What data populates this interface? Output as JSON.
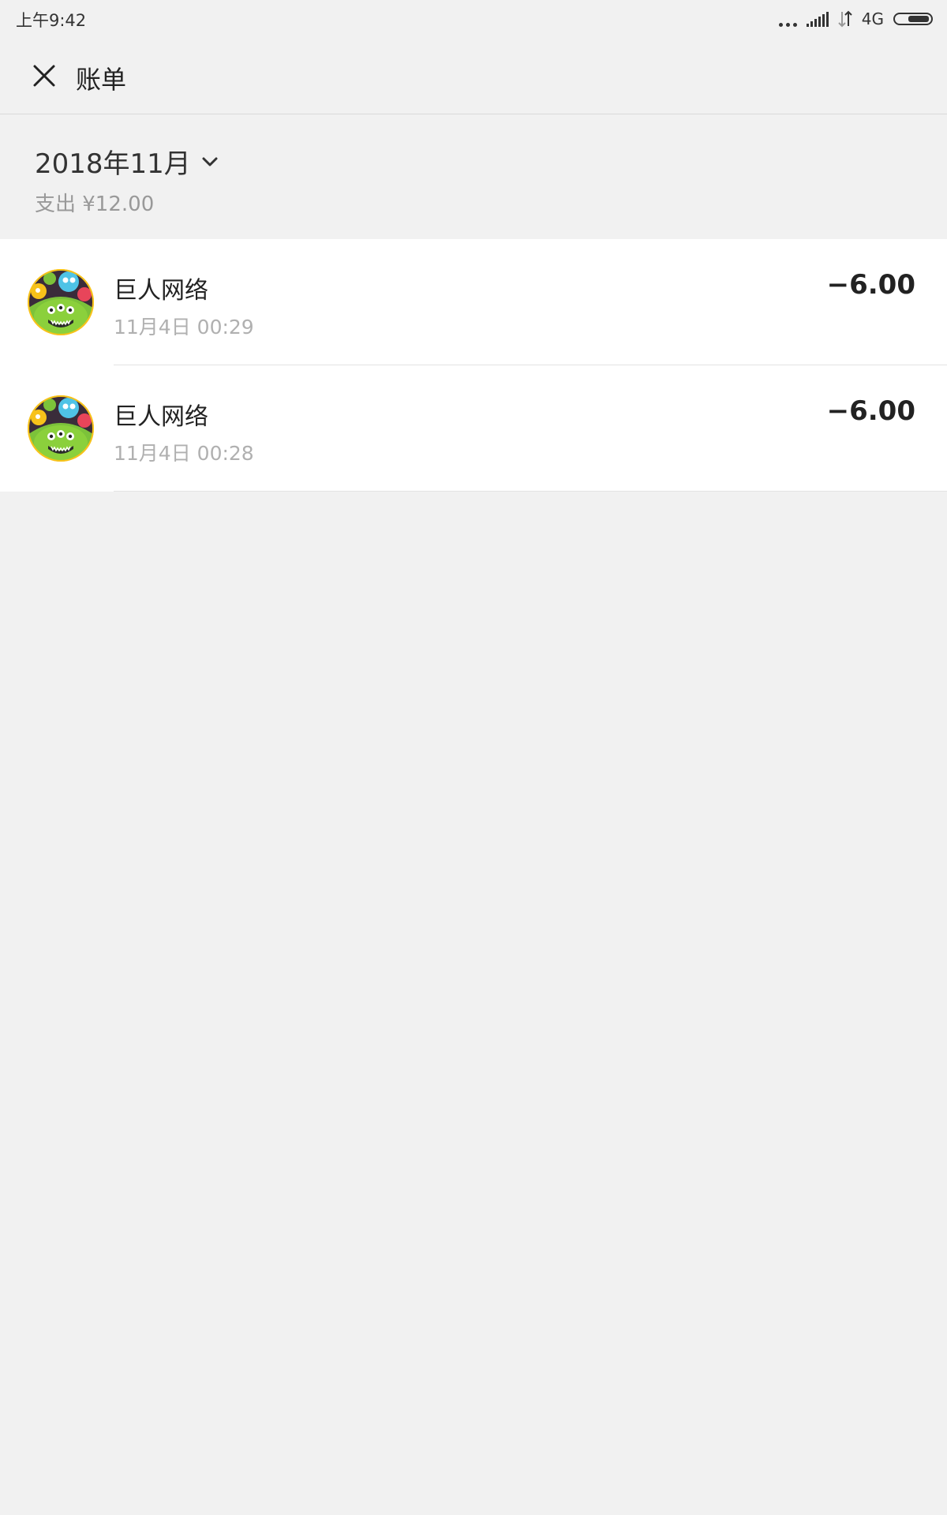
{
  "status_bar": {
    "time": "上午9:42",
    "network": "4G",
    "icons": [
      "more-dots-icon",
      "signal-icon",
      "data-arrows-icon",
      "battery-icon"
    ]
  },
  "header": {
    "title": "账单",
    "close_icon": "close-icon"
  },
  "summary": {
    "month": "2018年11月",
    "dropdown_icon": "chevron-down-icon",
    "expense": "支出 ¥12.00"
  },
  "transactions": [
    {
      "name": "巨人网络",
      "datetime": "11月4日 00:29",
      "amount": "−6.00",
      "avatar_icon": "monster-game-avatar-icon"
    },
    {
      "name": "巨人网络",
      "datetime": "11月4日 00:28",
      "amount": "−6.00",
      "avatar_icon": "monster-game-avatar-icon"
    }
  ],
  "colors": {
    "background": "#f1f1f1",
    "list_background": "#ffffff",
    "primary_text": "#222222",
    "secondary_text": "#999999",
    "avatar_green": "#7cc23a",
    "avatar_yellow": "#f7c21a"
  }
}
